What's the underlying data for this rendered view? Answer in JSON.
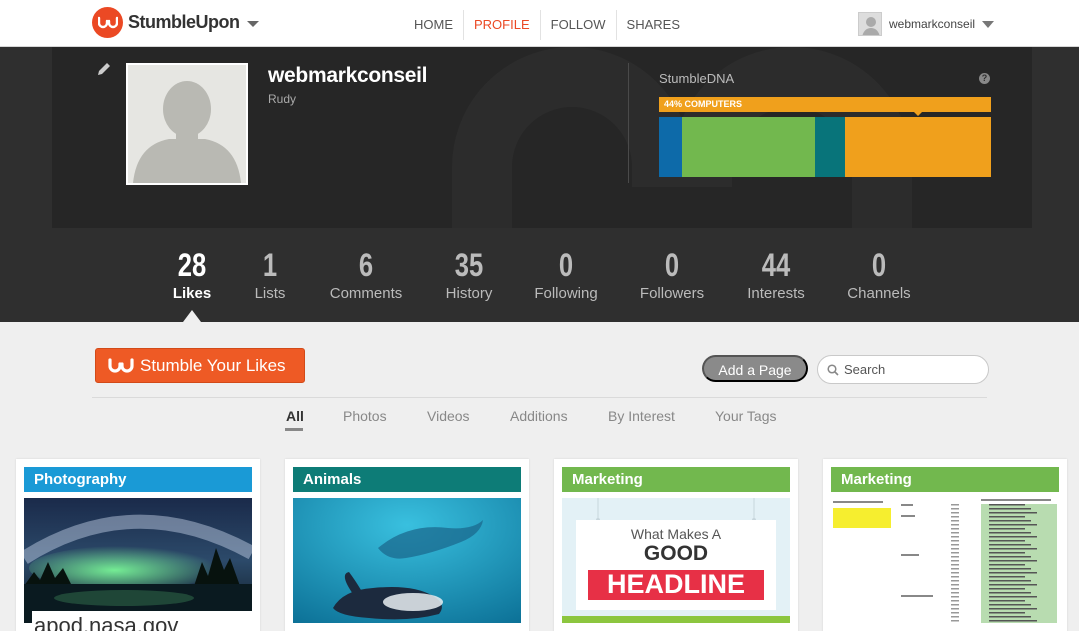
{
  "brand": {
    "name": "StumbleUpon",
    "accent": "#eb4924"
  },
  "nav": [
    {
      "label": "HOME",
      "active": false
    },
    {
      "label": "PROFILE",
      "active": true
    },
    {
      "label": "FOLLOW",
      "active": false
    },
    {
      "label": "SHARES",
      "active": false
    }
  ],
  "user": {
    "name": "webmarkconseil"
  },
  "profile": {
    "username": "webmarkconseil",
    "real_name": "Rudy",
    "dna": {
      "title": "StumbleDNA",
      "help": "?",
      "top_label": "44% COMPUTERS",
      "segments": [
        {
          "share": 0.07,
          "color": "#0d6aa9"
        },
        {
          "share": 0.4,
          "color": "#72b84e"
        },
        {
          "share": 0.09,
          "color": "#08747a"
        },
        {
          "share": 0.44,
          "color": "#f0a01c"
        }
      ]
    }
  },
  "stats": [
    {
      "num": "28",
      "label": "Likes",
      "active": true
    },
    {
      "num": "1",
      "label": "Lists",
      "active": false
    },
    {
      "num": "6",
      "label": "Comments",
      "active": false
    },
    {
      "num": "35",
      "label": "History",
      "active": false
    },
    {
      "num": "0",
      "label": "Following",
      "active": false
    },
    {
      "num": "0",
      "label": "Followers",
      "active": false
    },
    {
      "num": "44",
      "label": "Interests",
      "active": false
    },
    {
      "num": "0",
      "label": "Channels",
      "active": false
    }
  ],
  "toolbar": {
    "stumble_label": "Stumble Your Likes",
    "add_page_label": "Add a Page",
    "search_placeholder": "Search"
  },
  "tabs": [
    {
      "label": "All",
      "active": true
    },
    {
      "label": "Photos",
      "active": false
    },
    {
      "label": "Videos",
      "active": false
    },
    {
      "label": "Additions",
      "active": false
    },
    {
      "label": "By Interest",
      "active": false
    },
    {
      "label": "Your Tags",
      "active": false
    }
  ],
  "cards": [
    {
      "tag": "Photography",
      "tag_color": "#1a9ad6",
      "title": "apod.nasa.gov"
    },
    {
      "tag": "Animals",
      "tag_color": "#0d7c77",
      "title": ""
    },
    {
      "tag": "Marketing",
      "tag_color": "#72b84e",
      "title": "",
      "image_text": {
        "line1": "What Makes A",
        "line2": "GOOD",
        "line3": "HEADLINE"
      }
    },
    {
      "tag": "Marketing",
      "tag_color": "#72b84e",
      "title": ""
    }
  ]
}
